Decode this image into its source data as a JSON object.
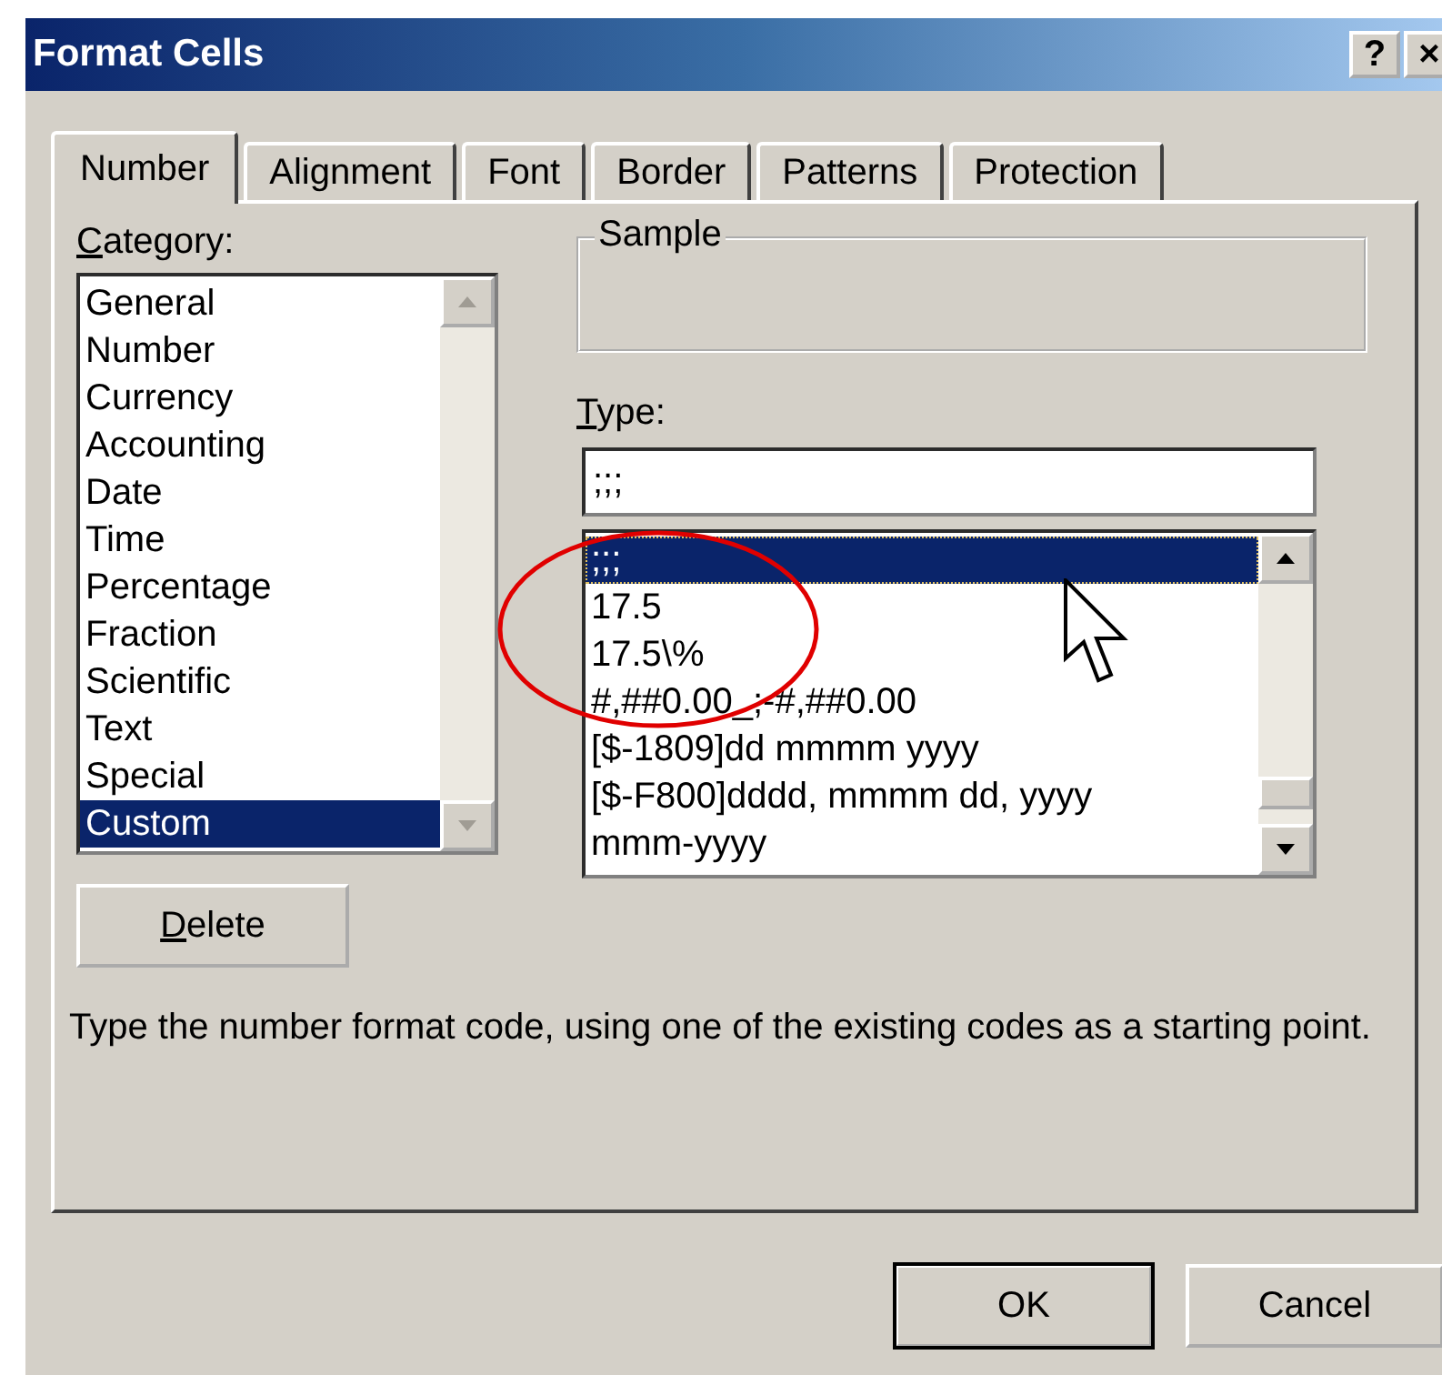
{
  "window": {
    "title": "Format Cells",
    "title_buttons": [
      {
        "label": "?"
      },
      {
        "label": "×"
      }
    ]
  },
  "tabs": [
    {
      "label": "Number",
      "selected": true
    },
    {
      "label": "Alignment",
      "selected": false
    },
    {
      "label": "Font",
      "selected": false
    },
    {
      "label": "Border",
      "selected": false
    },
    {
      "label": "Patterns",
      "selected": false
    },
    {
      "label": "Protection",
      "selected": false
    }
  ],
  "category": {
    "label": "Category:",
    "items": [
      {
        "label": "General",
        "selected": false
      },
      {
        "label": "Number",
        "selected": false
      },
      {
        "label": "Currency",
        "selected": false
      },
      {
        "label": "Accounting",
        "selected": false
      },
      {
        "label": "Date",
        "selected": false
      },
      {
        "label": "Time",
        "selected": false
      },
      {
        "label": "Percentage",
        "selected": false
      },
      {
        "label": "Fraction",
        "selected": false
      },
      {
        "label": "Scientific",
        "selected": false
      },
      {
        "label": "Text",
        "selected": false
      },
      {
        "label": "Special",
        "selected": false
      },
      {
        "label": "Custom",
        "selected": true
      }
    ]
  },
  "sample": {
    "label": "Sample"
  },
  "type": {
    "label": "Type:",
    "value": ";;;",
    "items": [
      {
        "label": ";;;",
        "selected": true
      },
      {
        "label": "17.5",
        "selected": false
      },
      {
        "label": "17.5\\%",
        "selected": false
      },
      {
        "label": "#,##0.00_;-#,##0.00",
        "selected": false
      },
      {
        "label": "[$-1809]dd mmmm yyyy",
        "selected": false
      },
      {
        "label": "[$-F800]dddd, mmmm dd, yyyy",
        "selected": false
      },
      {
        "label": "mmm-yyyy",
        "selected": false
      }
    ]
  },
  "delete_button": {
    "label": "Delete"
  },
  "description": "Type the number format code, using one of the existing codes as a starting point.",
  "buttons": [
    {
      "label": "OK",
      "default": true
    },
    {
      "label": "Cancel",
      "default": false
    }
  ]
}
